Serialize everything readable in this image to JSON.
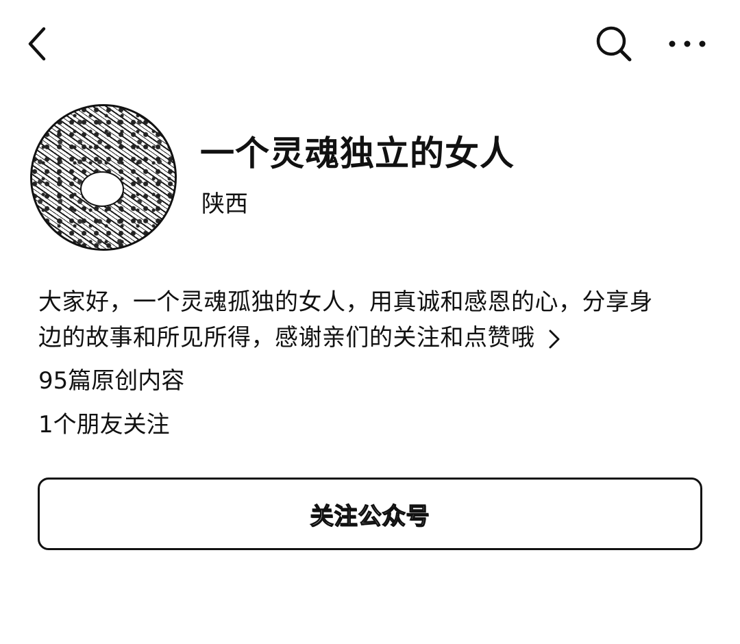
{
  "header": {
    "back_icon": "back-chevron-icon",
    "search_icon": "search-icon",
    "more_icon": "more-dots-icon"
  },
  "profile": {
    "name": "一个灵魂独立的女人",
    "region": "陕西",
    "intro_line1": "大家好，一个灵魂孤独的女人，用真诚和感恩的心，分享身",
    "intro_line2": "边的故事和所见所得，感谢亲们的关注和点赞哦",
    "original_articles": "95篇原创内容",
    "friends_following": "1个朋友关注"
  },
  "actions": {
    "follow_label": "关注公众号"
  }
}
